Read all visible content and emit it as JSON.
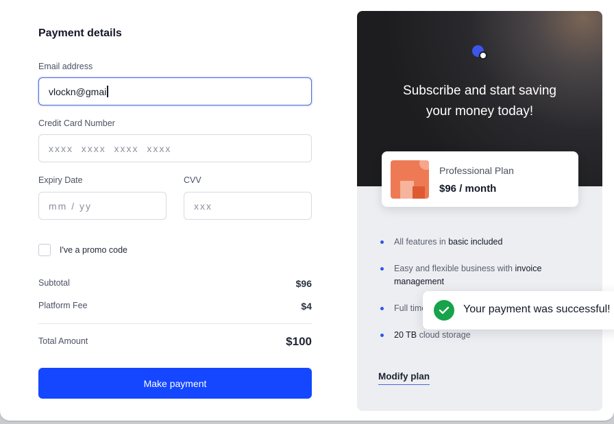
{
  "payment": {
    "title": "Payment details",
    "email_label": "Email address",
    "email_value": "vlockn@gmai",
    "card_label": "Credit Card Number",
    "card_placeholder": "xxxx  xxxx  xxxx  xxxx",
    "expiry_label": "Expiry Date",
    "expiry_placeholder": "mm / yy",
    "cvv_label": "CVV",
    "cvv_placeholder": "xxx",
    "promo_label": "I've a promo code",
    "promo_checked": false
  },
  "summary": {
    "subtotal_label": "Subtotal",
    "subtotal_value": "$96",
    "fee_label": "Platform Fee",
    "fee_value": "$4",
    "total_label": "Total Amount",
    "total_value": "$100"
  },
  "actions": {
    "pay_label": "Make payment"
  },
  "promo_panel": {
    "headline_line1": "Subscribe and start saving",
    "headline_line2": "your money today!",
    "plan_name": "Professional Plan",
    "plan_price": "$96 / month",
    "features": [
      {
        "pre": "All features in ",
        "strong": "basic included",
        "post": ""
      },
      {
        "pre": "Easy and flexible business with ",
        "strong": "invoice management",
        "post": ""
      },
      {
        "pre": "Full time",
        "strong": "",
        "post": ""
      },
      {
        "pre": "",
        "strong": "20 TB",
        "post": " cloud storage"
      }
    ],
    "modify_label": "Modify plan"
  },
  "toast": {
    "message": "Your payment was successful!"
  },
  "colors": {
    "primary": "#1447ff",
    "success": "#16a34a",
    "accent": "#3d55ea"
  }
}
